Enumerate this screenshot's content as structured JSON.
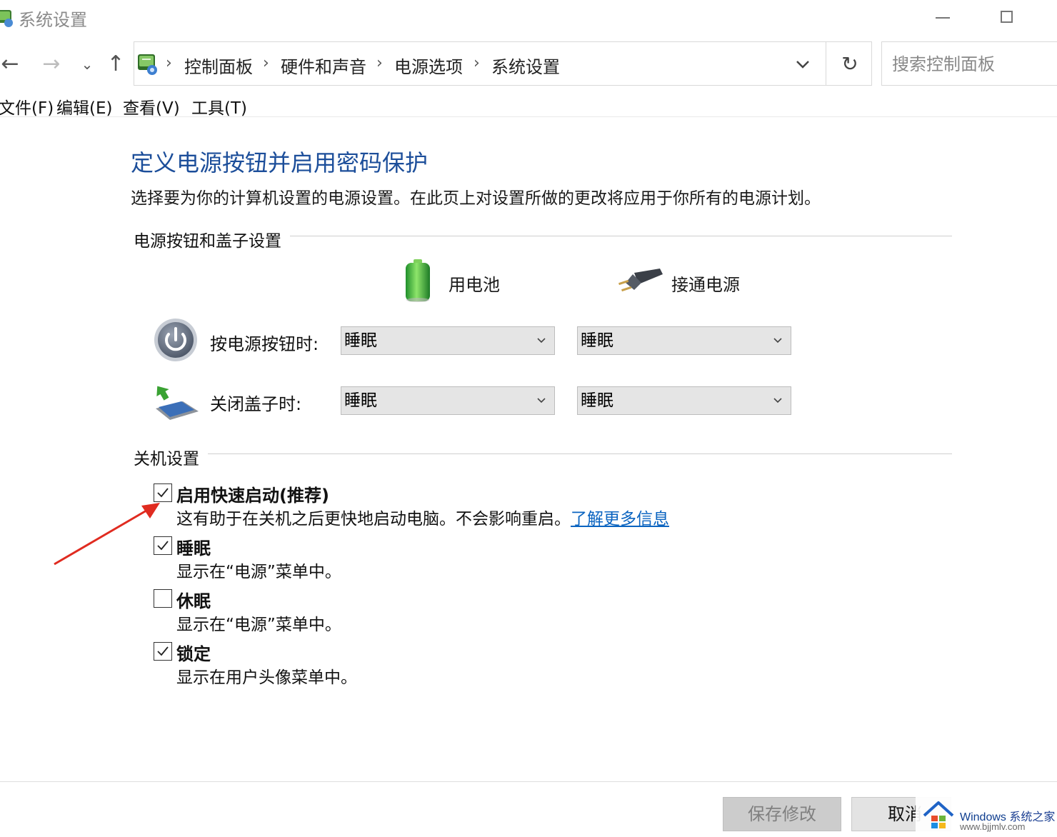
{
  "window": {
    "title": "系统设置"
  },
  "nav": {
    "breadcrumb": [
      "控制面板",
      "硬件和声音",
      "电源选项",
      "系统设置"
    ],
    "search_placeholder": "搜索控制面板"
  },
  "menu": [
    "文件(F)",
    "编辑(E)",
    "查看(V)",
    "工具(T)"
  ],
  "page": {
    "heading": "定义电源按钮并启用密码保护",
    "subtitle": "选择要为你的计算机设置的电源设置。在此页上对设置所做的更改将应用于你所有的电源计划。"
  },
  "power_section": {
    "title": "电源按钮和盖子设置",
    "col_battery": "用电池",
    "col_plugged": "接通电源",
    "rows": [
      {
        "label": "按电源按钮时:",
        "battery": "睡眠",
        "plugged": "睡眠"
      },
      {
        "label": "关闭盖子时:",
        "battery": "睡眠",
        "plugged": "睡眠"
      }
    ]
  },
  "shutdown_section": {
    "title": "关机设置",
    "items": [
      {
        "title": "启用快速启动(推荐)",
        "desc": "这有助于在关机之后更快地启动电脑。不会影响重启。",
        "link": "了解更多信息",
        "checked": true
      },
      {
        "title": "睡眠",
        "desc": "显示在“电源”菜单中。",
        "checked": true
      },
      {
        "title": "休眠",
        "desc": "显示在“电源”菜单中。",
        "checked": false
      },
      {
        "title": "锁定",
        "desc": "显示在用户头像菜单中。",
        "checked": true
      }
    ]
  },
  "buttons": {
    "save": "保存修改",
    "cancel": "取消"
  },
  "watermark": {
    "brand": "Windows",
    "brand_cn": "系统之家",
    "url": "www.bjjmlv.com"
  },
  "colors": {
    "heading": "#1c4e9a",
    "link": "#0b64c0",
    "annotation_arrow": "#e02b20"
  }
}
